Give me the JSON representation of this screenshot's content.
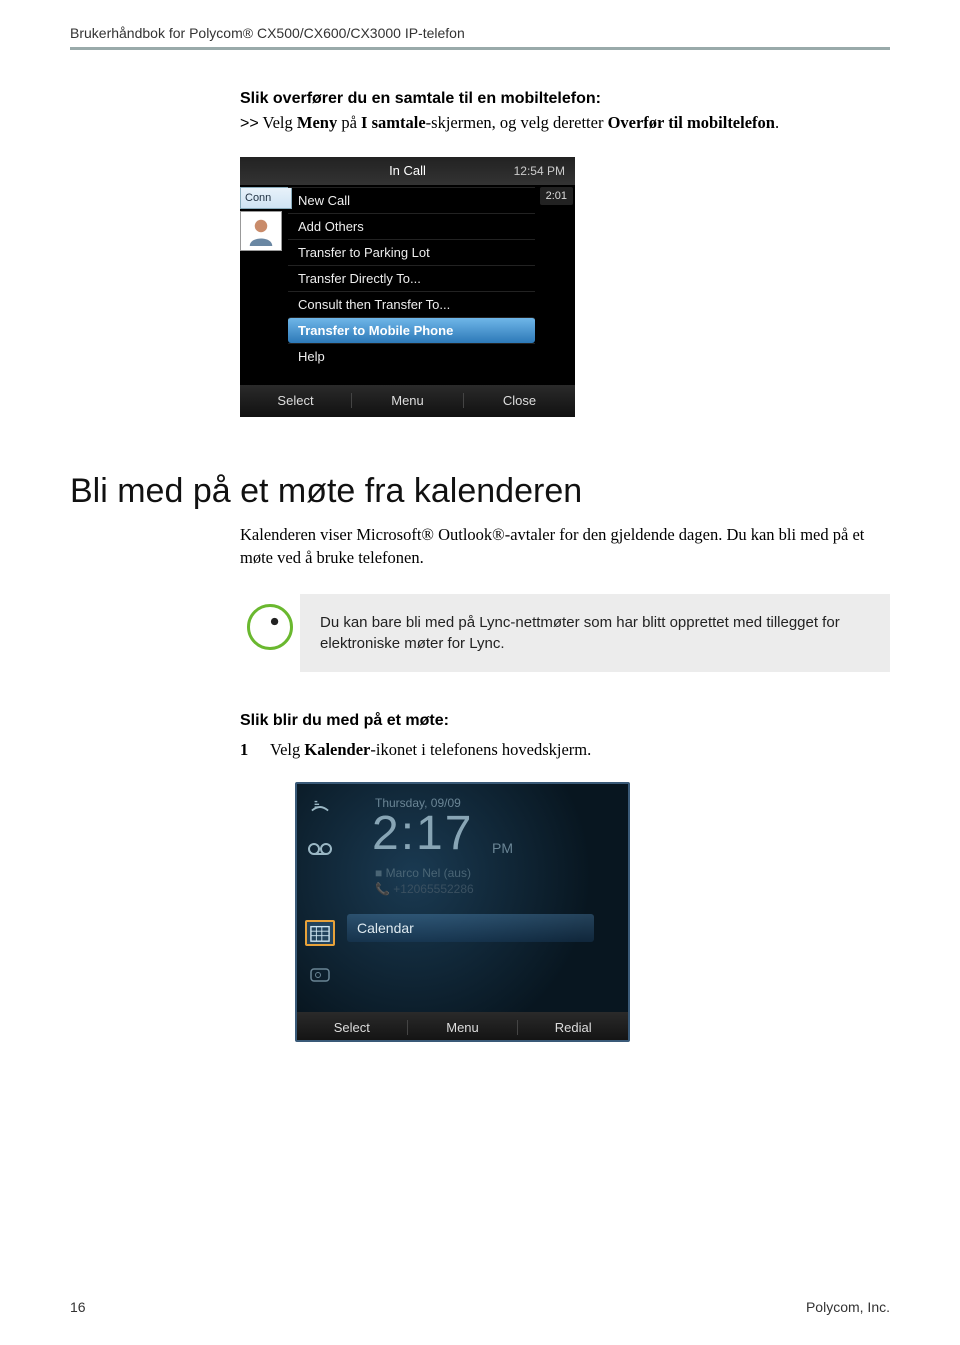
{
  "header": {
    "title": "Brukerhåndbok for Polycom® CX500/CX600/CX3000 IP-telefon"
  },
  "section1": {
    "heading": "Slik overfører du en samtale til en mobiltelefon:",
    "line_prefix": ">>",
    "line_part1": "Velg ",
    "line_bold1": "Meny",
    "line_part2": " på ",
    "line_bold2": "I samtale",
    "line_part3": "-skjermen, og velg deretter ",
    "line_bold3": "Overfør til mobiltelefon",
    "line_part4": "."
  },
  "screenshot1": {
    "title": "In Call",
    "time": "12:54 PM",
    "conn": "Conn",
    "duration": "2:01",
    "menu": [
      "New Call",
      "Add Others",
      "Transfer to Parking Lot",
      "Transfer Directly To...",
      "Consult then Transfer To...",
      "Transfer to Mobile Phone",
      "Help"
    ],
    "selected_index": 5,
    "softkeys": [
      "Select",
      "Menu",
      "Close"
    ]
  },
  "section2": {
    "heading": "Bli med på et møte fra kalenderen",
    "para1": "Kalenderen viser Microsoft® Outlook®-avtaler for den gjeldende dagen. Du kan bli med på et møte ved å bruke telefonen.",
    "note": "Du kan bare bli med på Lync-nettmøter som har blitt opprettet med tillegget for elektroniske møter for Lync.",
    "step_heading": "Slik blir du med på et møte:",
    "step_num": "1",
    "step_part1": "Velg ",
    "step_bold1": "Kalender",
    "step_part2": "-ikonet i telefonens hovedskjerm."
  },
  "screenshot2": {
    "date": "Thursday, 09/09",
    "time": "2:17",
    "ampm": "PM",
    "user": "Marco Nel (aus)",
    "phone": "+12065552286",
    "calendar_label": "Calendar",
    "softkeys": [
      "Select",
      "Menu",
      "Redial"
    ]
  },
  "footer": {
    "page": "16",
    "company": "Polycom, Inc."
  }
}
